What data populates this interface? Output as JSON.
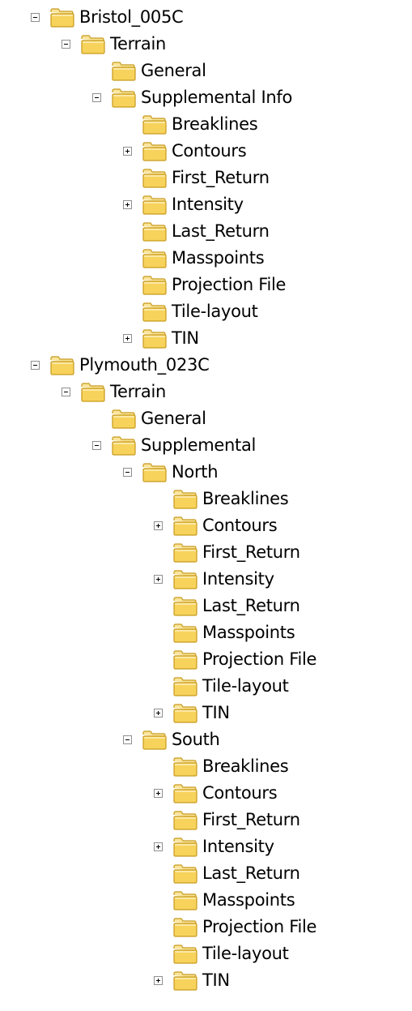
{
  "colors": {
    "folder_body": "#f7d35c",
    "folder_top": "#fbe59a",
    "folder_edge": "#c79a1c",
    "toggle_border": "#8e8f8f"
  },
  "tree": [
    {
      "label": "Bristol_005C",
      "depth": 0,
      "toggle": "minus"
    },
    {
      "label": "Terrain",
      "depth": 1,
      "toggle": "minus"
    },
    {
      "label": "General",
      "depth": 2,
      "toggle": "none"
    },
    {
      "label": "Supplemental Info",
      "depth": 2,
      "toggle": "minus"
    },
    {
      "label": "Breaklines",
      "depth": 3,
      "toggle": "none"
    },
    {
      "label": "Contours",
      "depth": 3,
      "toggle": "plus"
    },
    {
      "label": "First_Return",
      "depth": 3,
      "toggle": "none"
    },
    {
      "label": "Intensity",
      "depth": 3,
      "toggle": "plus"
    },
    {
      "label": "Last_Return",
      "depth": 3,
      "toggle": "none"
    },
    {
      "label": "Masspoints",
      "depth": 3,
      "toggle": "none"
    },
    {
      "label": "Projection File",
      "depth": 3,
      "toggle": "none"
    },
    {
      "label": "Tile-layout",
      "depth": 3,
      "toggle": "none"
    },
    {
      "label": "TIN",
      "depth": 3,
      "toggle": "plus"
    },
    {
      "label": "Plymouth_023C",
      "depth": 0,
      "toggle": "minus"
    },
    {
      "label": "Terrain",
      "depth": 1,
      "toggle": "minus"
    },
    {
      "label": "General",
      "depth": 2,
      "toggle": "none"
    },
    {
      "label": "Supplemental",
      "depth": 2,
      "toggle": "minus"
    },
    {
      "label": "North",
      "depth": 3,
      "toggle": "minus"
    },
    {
      "label": "Breaklines",
      "depth": 4,
      "toggle": "none"
    },
    {
      "label": "Contours",
      "depth": 4,
      "toggle": "plus"
    },
    {
      "label": "First_Return",
      "depth": 4,
      "toggle": "none"
    },
    {
      "label": "Intensity",
      "depth": 4,
      "toggle": "plus"
    },
    {
      "label": "Last_Return",
      "depth": 4,
      "toggle": "none"
    },
    {
      "label": "Masspoints",
      "depth": 4,
      "toggle": "none"
    },
    {
      "label": "Projection File",
      "depth": 4,
      "toggle": "none"
    },
    {
      "label": "Tile-layout",
      "depth": 4,
      "toggle": "none"
    },
    {
      "label": "TIN",
      "depth": 4,
      "toggle": "plus"
    },
    {
      "label": "South",
      "depth": 3,
      "toggle": "minus"
    },
    {
      "label": "Breaklines",
      "depth": 4,
      "toggle": "none"
    },
    {
      "label": "Contours",
      "depth": 4,
      "toggle": "plus"
    },
    {
      "label": "First_Return",
      "depth": 4,
      "toggle": "none"
    },
    {
      "label": "Intensity",
      "depth": 4,
      "toggle": "plus"
    },
    {
      "label": "Last_Return",
      "depth": 4,
      "toggle": "none"
    },
    {
      "label": "Masspoints",
      "depth": 4,
      "toggle": "none"
    },
    {
      "label": "Projection File",
      "depth": 4,
      "toggle": "none"
    },
    {
      "label": "Tile-layout",
      "depth": 4,
      "toggle": "none"
    },
    {
      "label": "TIN",
      "depth": 4,
      "toggle": "plus"
    }
  ]
}
